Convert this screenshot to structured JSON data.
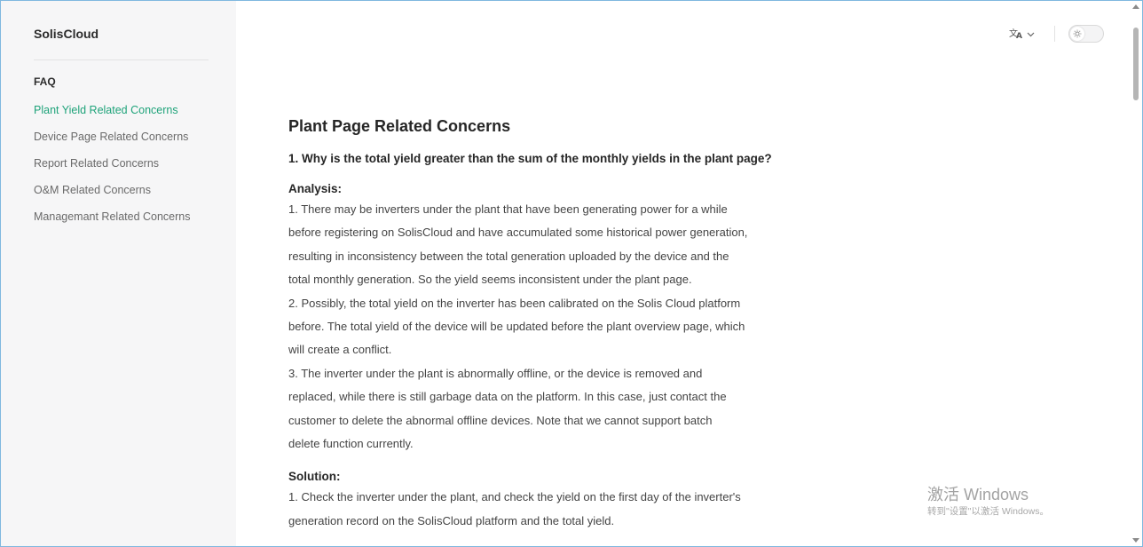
{
  "app": {
    "brand": "SolisCloud"
  },
  "sidebar": {
    "section": "FAQ",
    "items": [
      {
        "label": "Plant Yield Related Concerns",
        "active": true
      },
      {
        "label": "Device Page Related Concerns",
        "active": false
      },
      {
        "label": "Report Related Concerns",
        "active": false
      },
      {
        "label": "O&M Related Concerns",
        "active": false
      },
      {
        "label": "Managemant Related Concerns",
        "active": false
      }
    ]
  },
  "toolbar": {
    "language_icon": "translate-icon",
    "dropdown_icon": "chevron-down-icon",
    "theme_icon": "sun-icon"
  },
  "content": {
    "title": "Plant Page Related Concerns",
    "question": "1. Why is the total yield greater than the sum of the monthly yields in the plant page?",
    "analysis_heading": "Analysis:",
    "analysis_lines": [
      "1. There may be inverters under the plant that have been generating power for a while",
      "before registering on SolisCloud and have accumulated some historical power generation,",
      "resulting in inconsistency between the total generation uploaded by the device and the",
      "total monthly generation. So the yield seems inconsistent under the plant page.",
      "2. Possibly, the total yield on the inverter has been calibrated on the Solis Cloud platform",
      "before. The total yield of the device will be updated before the plant overview page, which",
      "will create a conflict.",
      "3. The inverter under the plant is abnormally offline, or the device is removed and",
      "replaced, while there is still garbage data on the platform. In this case, just contact the",
      "customer to delete the abnormal offline devices. Note that we cannot support batch",
      "delete function currently."
    ],
    "solution_heading": "Solution:",
    "solution_lines": [
      "1. Check the inverter under the plant, and check the yield on the first day of the inverter's",
      "generation record on the SolisCloud platform and the total yield."
    ]
  },
  "watermark": {
    "title": "激活 Windows",
    "subtitle": "转到\"设置\"以激活 Windows。"
  },
  "colors": {
    "accent": "#1fa37a",
    "sidebar_bg": "#f6f6f7",
    "frame_border": "#7fb8df"
  }
}
